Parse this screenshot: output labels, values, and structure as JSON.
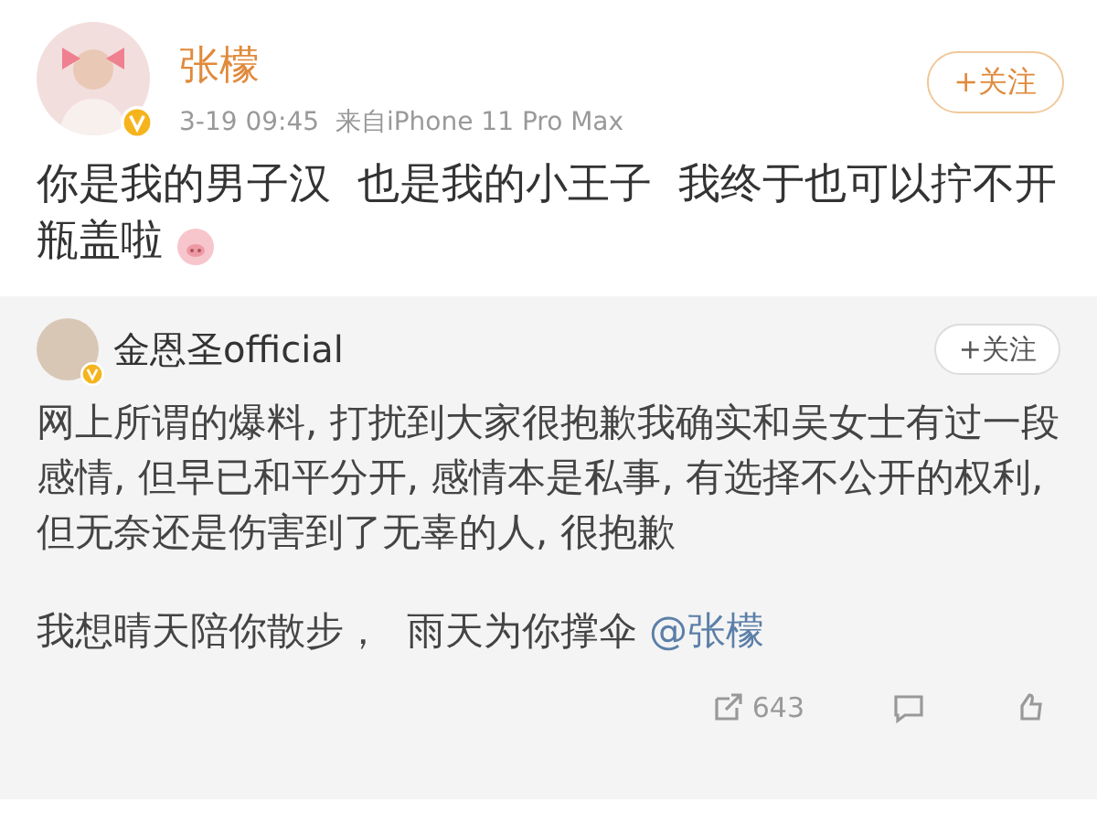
{
  "post": {
    "author": "张檬",
    "verified": true,
    "meta": "3-19 09:45  来自iPhone 11 Pro Max",
    "follow": "+关注",
    "text": "你是我的男子汉  也是我的小王子  我终于也可以拧不开瓶盖啦"
  },
  "repost": {
    "author": "金恩圣official",
    "verified": true,
    "follow": "+关注",
    "paragraphs": [
      {
        "text": "网上所谓的爆料, 打扰到大家很抱歉我确实和吴女士有过一段感情, 但早已和平分开, 感情本是私事, 有选择不公开的权利, 但无奈还是伤害到了无辜的人, 很抱歉"
      },
      {
        "text": "我想晴天陪你散步，  雨天为你撑伞",
        "mention": "@张檬"
      }
    ],
    "stats": [
      {
        "kind": "share",
        "count": "643"
      },
      {
        "kind": "comment"
      },
      {
        "kind": "like"
      }
    ]
  }
}
